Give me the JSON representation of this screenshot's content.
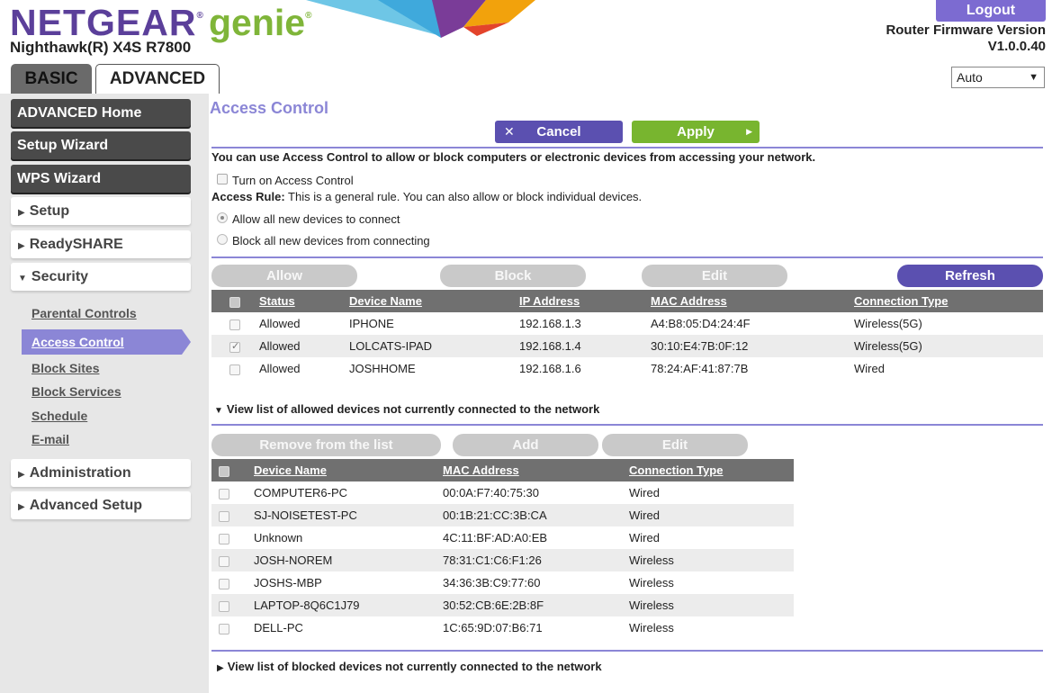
{
  "header": {
    "brand": "NETGEAR",
    "brand_mark": "®",
    "product": "genie",
    "product_mark": "®",
    "model": "Nighthawk(R) X4S R7800",
    "logout_label": "Logout",
    "firmware_label": "Router Firmware Version",
    "firmware_version": "V1.0.0.40",
    "language_selected": "Auto",
    "tabs": [
      {
        "label": "BASIC",
        "active": false
      },
      {
        "label": "ADVANCED",
        "active": true
      }
    ]
  },
  "sidebar": {
    "buttons": [
      "ADVANCED Home",
      "Setup Wizard",
      "WPS Wizard"
    ],
    "sections": {
      "setup": "Setup",
      "readyshare": "ReadySHARE",
      "security": "Security",
      "administration": "Administration",
      "advanced_setup": "Advanced Setup"
    },
    "security_links": [
      "Parental Controls",
      "Access Control",
      "Block Sites",
      "Block Services",
      "Schedule",
      "E-mail"
    ],
    "active_link": "Access Control"
  },
  "main": {
    "title": "Access Control",
    "cancel_label": "Cancel",
    "apply_label": "Apply",
    "intro": "You can use Access Control to allow or block computers or electronic devices from accessing your network.",
    "turn_on_label": "Turn on Access Control",
    "access_rule_label": "Access Rule:",
    "access_rule_text": "This is a general rule. You can also allow or block individual devices.",
    "radio_allow": "Allow all new devices to connect",
    "radio_block": "Block all new devices from connecting",
    "actions": {
      "allow": "Allow",
      "block": "Block",
      "edit": "Edit",
      "refresh": "Refresh"
    },
    "connected_headers": [
      "Status",
      "Device Name",
      "IP Address",
      "MAC Address",
      "Connection Type"
    ],
    "connected_rows": [
      {
        "checked": false,
        "status": "Allowed",
        "name": "IPHONE",
        "ip": "192.168.1.3",
        "mac": "A4:B8:05:D4:24:4F",
        "type": "Wireless(5G)"
      },
      {
        "checked": true,
        "status": "Allowed",
        "name": "LOLCATS-IPAD",
        "ip": "192.168.1.4",
        "mac": "30:10:E4:7B:0F:12",
        "type": "Wireless(5G)"
      },
      {
        "checked": false,
        "status": "Allowed",
        "name": "JOSHHOME",
        "ip": "192.168.1.6",
        "mac": "78:24:AF:41:87:7B",
        "type": "Wired"
      }
    ],
    "allowed_toggle": "View list of allowed devices not currently connected to the network",
    "allowed_actions": {
      "remove": "Remove from the list",
      "add": "Add",
      "edit": "Edit"
    },
    "allowed_headers": [
      "Device Name",
      "MAC Address",
      "Connection Type"
    ],
    "allowed_rows": [
      {
        "name": "COMPUTER6-PC",
        "mac": "00:0A:F7:40:75:30",
        "type": "Wired"
      },
      {
        "name": "SJ-NOISETEST-PC",
        "mac": "00:1B:21:CC:3B:CA",
        "type": "Wired"
      },
      {
        "name": "Unknown",
        "mac": "4C:11:BF:AD:A0:EB",
        "type": "Wired"
      },
      {
        "name": "JOSH-NOREM",
        "mac": "78:31:C1:C6:F1:26",
        "type": "Wireless"
      },
      {
        "name": "JOSHS-MBP",
        "mac": "34:36:3B:C9:77:60",
        "type": "Wireless"
      },
      {
        "name": "LAPTOP-8Q6C1J79",
        "mac": "30:52:CB:6E:2B:8F",
        "type": "Wireless"
      },
      {
        "name": "DELL-PC",
        "mac": "1C:65:9D:07:B6:71",
        "type": "Wireless"
      }
    ],
    "blocked_toggle": "View list of blocked devices not currently connected to the network"
  },
  "colors": {
    "brand_purple": "#5b3f9a",
    "genie_green": "#7fb539",
    "accent_lavender": "#8b86d6",
    "button_purple": "#5b50b0",
    "apply_green": "#78b52f",
    "allowed_green": "#3f8a1c"
  }
}
